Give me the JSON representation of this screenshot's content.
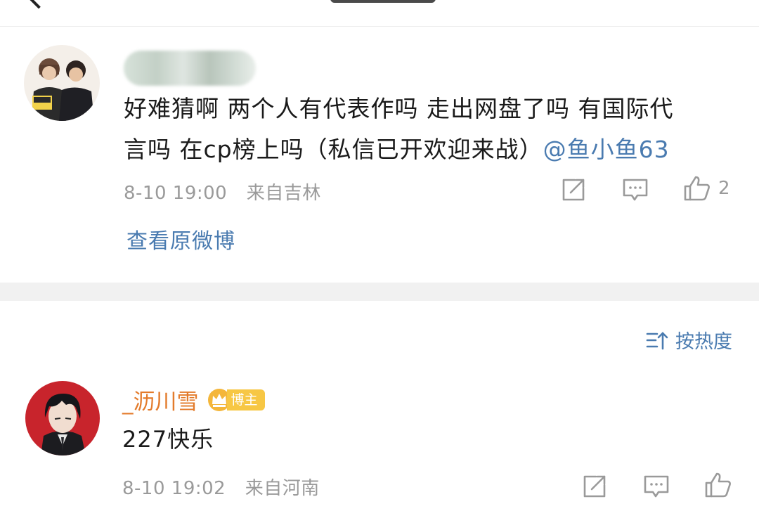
{
  "post": {
    "author_name": "",
    "text_line1": "好难猜啊 两个人有代表作吗 走出网盘了吗 有国际代",
    "text_line2_plain": "言吗 在cp榜上吗（私信已开欢迎来战）",
    "mention": "@鱼小鱼63",
    "timestamp": "8-10 19:00",
    "location": "来自吉林",
    "like_count": "2",
    "view_original_label": "查看原微博"
  },
  "comments_header": {
    "sort_label": "按热度"
  },
  "comment": {
    "username": "_沥川雪",
    "badge": "博主",
    "text": "227快乐",
    "timestamp": "8-10 19:02",
    "location": "来自河南"
  },
  "icons": {
    "back": "chevron-left-icon",
    "share": "share-icon",
    "comment": "comment-icon",
    "like": "thumbs-up-icon",
    "sort": "sort-icon",
    "crown": "crown-icon"
  },
  "colors": {
    "link_blue": "#4a7bb0",
    "meta_gray": "#9a9a9a",
    "username_orange": "#e37b2b",
    "badge_gold": "#f7c744",
    "divider_gray": "#f1f1f1"
  }
}
